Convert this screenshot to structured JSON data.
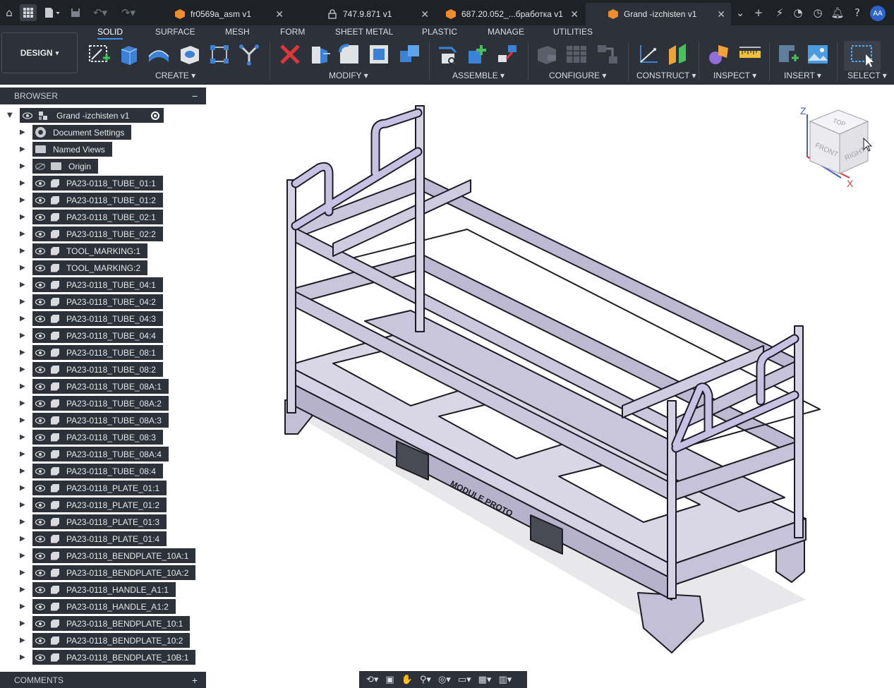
{
  "tabs": [
    {
      "label": "fr0569a_asm v1",
      "icon": "cube-icon"
    },
    {
      "label": "747.9.871 v1",
      "icon": "lock-icon"
    },
    {
      "label": "687.20.052_...бработка v1",
      "icon": "cube-icon"
    },
    {
      "label": "Grand -izchisten v1",
      "icon": "cube-icon",
      "active": true
    }
  ],
  "user_initials": "AA",
  "workspace": "DESIGN",
  "ribbon_tabs": [
    "SOLID",
    "SURFACE",
    "MESH",
    "FORM",
    "SHEET METAL",
    "PLASTIC",
    "MANAGE",
    "UTILITIES"
  ],
  "active_ribbon_tab": "SOLID",
  "ribbon_groups": [
    "CREATE",
    "MODIFY",
    "ASSEMBLE",
    "CONFIGURE",
    "CONSTRUCT",
    "INSPECT",
    "INSERT",
    "SELECT"
  ],
  "browser": {
    "title": "BROWSER",
    "root": "Grand -izchisten v1",
    "items": [
      "Document Settings",
      "Named Views",
      "Origin",
      "PA23-0118_TUBE_01:1",
      "PA23-0118_TUBE_01:2",
      "PA23-0118_TUBE_02:1",
      "PA23-0118_TUBE_02:2",
      "TOOL_MARKING:1",
      "TOOL_MARKING:2",
      "PA23-0118_TUBE_04:1",
      "PA23-0118_TUBE_04:2",
      "PA23-0118_TUBE_04:3",
      "PA23-0118_TUBE_04:4",
      "PA23-0118_TUBE_08:1",
      "PA23-0118_TUBE_08:2",
      "PA23-0118_TUBE_08A:1",
      "PA23-0118_TUBE_08A:2",
      "PA23-0118_TUBE_08A:3",
      "PA23-0118_TUBE_08:3",
      "PA23-0118_TUBE_08A:4",
      "PA23-0118_TUBE_08:4",
      "PA23-0118_PLATE_01:1",
      "PA23-0118_PLATE_01:2",
      "PA23-0118_PLATE_01:3",
      "PA23-0118_PLATE_01:4",
      "PA23-0118_BENDPLATE_10A:1",
      "PA23-0118_BENDPLATE_10A:2",
      "PA23-0118_HANDLE_A1:1",
      "PA23-0118_HANDLE_A1:2",
      "PA23-0118_BENDPLATE_10:1",
      "PA23-0118_BENDPLATE_10:2",
      "PA23-0118_BENDPLATE_10B:1"
    ]
  },
  "comments_title": "COMMENTS",
  "viewcube": {
    "top": "TOP",
    "front": "FRONT",
    "right": "RIGHT",
    "axis_z": "Z",
    "axis_x": "X"
  },
  "model_label": "MODULE PROTO",
  "colors": {
    "accent": "#3a8fe6",
    "orange": "#f08c2c",
    "steel": "#c9c6dc"
  }
}
